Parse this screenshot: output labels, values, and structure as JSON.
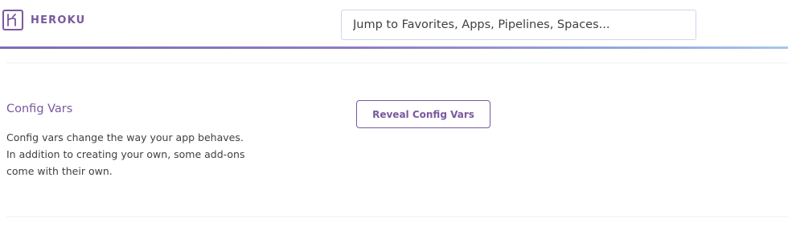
{
  "header": {
    "brand": "HEROKU",
    "search": {
      "placeholder": "Jump to Favorites, Apps, Pipelines, Spaces...",
      "value": ""
    }
  },
  "config_vars": {
    "title": "Config Vars",
    "description": "Config vars change the way your app behaves. In addition to creating your own, some add-ons come with their own.",
    "button_label": "Reveal Config Vars"
  },
  "colors": {
    "brand_purple": "#79589f",
    "text": "#3f3f44",
    "header_gradient_start": "#7f6bb9",
    "header_gradient_end": "#a6c6ec"
  },
  "icons": {
    "logo": "heroku-logo-icon"
  }
}
